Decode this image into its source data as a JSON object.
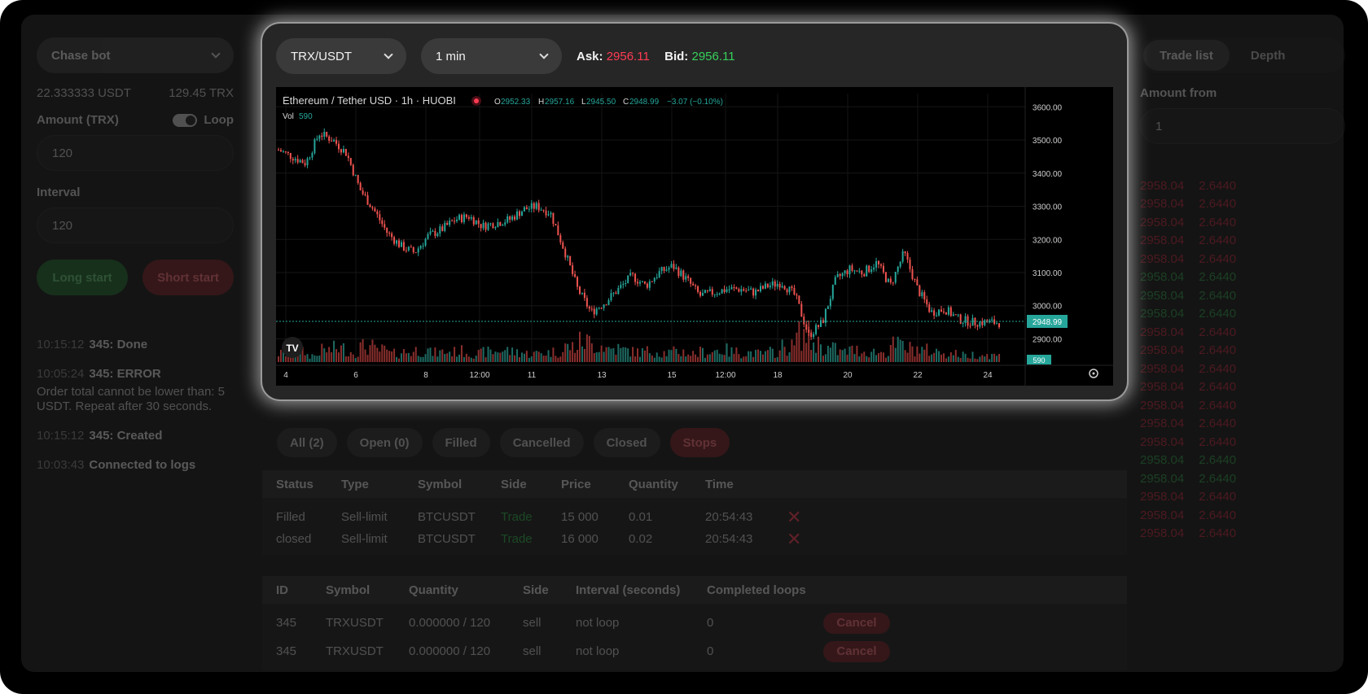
{
  "left": {
    "bot_select": "Chase bot",
    "balance_usdt": "22.333333 USDT",
    "balance_trx": "129.45 TRX",
    "amount_label": "Amount (TRX)",
    "loop_label": "Loop",
    "amount_value": "120",
    "interval_label": "Interval",
    "interval_value": "120",
    "long_button": "Long start",
    "short_button": "Short start",
    "logs": [
      {
        "time": "10:15:12",
        "msg": "345: Done",
        "detail": ""
      },
      {
        "time": "10:05:24",
        "msg": "345: ERROR",
        "detail": "Order total cannot be lower than: 5 USDT. Repeat after 30 seconds."
      },
      {
        "time": "10:15:12",
        "msg": "345: Created",
        "detail": ""
      },
      {
        "time": "10:03:43",
        "msg": "Connected to logs",
        "detail": ""
      }
    ]
  },
  "modal": {
    "pair": "TRX/USDT",
    "interval": "1 min",
    "ask_label": "Ask:",
    "ask_value": "2956.11",
    "bid_label": "Bid:",
    "bid_value": "2956.11"
  },
  "chart_data": {
    "type": "candlestick",
    "title": "Ethereum / Tether USD · 1h · HUOBI",
    "ohlc_text": {
      "o": "2952.33",
      "h": "2957.16",
      "l": "2945.50",
      "c": "2948.99",
      "chg": "−3.07 (−0.10%)"
    },
    "vol_label": "Vol",
    "vol_value": "590",
    "price_tag": "2948.99",
    "vol_tag": "590",
    "y_ticks": [
      "3600.00",
      "3500.00",
      "3400.00",
      "3300.00",
      "3200.00",
      "3100.00",
      "3000.00",
      "2900.00"
    ],
    "x_ticks": [
      "4",
      "6",
      "8",
      "12:00",
      "11",
      "13",
      "15",
      "12:00",
      "18",
      "20",
      "22",
      "24"
    ],
    "ylim": [
      2830,
      3640
    ],
    "close_path": [
      3470,
      3450,
      3430,
      3520,
      3500,
      3460,
      3350,
      3290,
      3220,
      3180,
      3160,
      3210,
      3230,
      3260,
      3270,
      3240,
      3250,
      3260,
      3290,
      3300,
      3280,
      3170,
      3050,
      2980,
      3010,
      3050,
      3090,
      3060,
      3100,
      3120,
      3080,
      3030,
      3040,
      3050,
      3050,
      3040,
      3060,
      3070,
      3030,
      2910,
      2950,
      3080,
      3110,
      3100,
      3130,
      3060,
      3160,
      3050,
      2980,
      2990,
      2960,
      2950,
      2950,
      2949
    ],
    "volume_path": [
      0.25,
      0.3,
      0.2,
      0.35,
      0.4,
      0.3,
      0.45,
      0.35,
      0.25,
      0.3,
      0.35,
      0.28,
      0.3,
      0.32,
      0.25,
      0.3,
      0.35,
      0.3,
      0.25,
      0.28,
      0.3,
      0.45,
      0.6,
      0.5,
      0.4,
      0.35,
      0.3,
      0.32,
      0.28,
      0.3,
      0.25,
      0.3,
      0.35,
      0.3,
      0.28,
      0.25,
      0.3,
      0.45,
      0.8,
      0.55,
      0.4,
      0.3,
      0.35,
      0.3,
      0.28,
      0.5,
      0.4,
      0.35,
      0.3,
      0.25,
      0.2,
      0.22,
      0.2,
      0.18
    ]
  },
  "tabs": [
    "All (2)",
    "Open (0)",
    "Filled",
    "Cancelled",
    "Closed",
    "Stops"
  ],
  "orders": {
    "headers": [
      "Status",
      "Type",
      "Symbol",
      "Side",
      "Price",
      "Quantity",
      "Time"
    ],
    "rows": [
      [
        "Filled",
        "Sell-limit",
        "BTCUSDT",
        "Trade",
        "15 000",
        "0.01",
        "20:54:43"
      ],
      [
        "closed",
        "Sell-limit",
        "BTCUSDT",
        "Trade",
        "16 000",
        "0.02",
        "20:54:43"
      ]
    ]
  },
  "bots": {
    "headers": [
      "ID",
      "Symbol",
      "Quantity",
      "Side",
      "Interval (seconds)",
      "Completed loops"
    ],
    "rows": [
      [
        "345",
        "TRXUSDT",
        "0.000000 / 120",
        "sell",
        "not loop",
        "0"
      ],
      [
        "345",
        "TRXUSDT",
        "0.000000 / 120",
        "sell",
        "not loop",
        "0"
      ]
    ],
    "cancel_label": "Cancel"
  },
  "right": {
    "tab_trade_list": "Trade list",
    "tab_depth": "Depth",
    "amount_from_label": "Amount from",
    "amount_from_value": "1",
    "orderbook": [
      {
        "price": "2958.04",
        "amount": "2.6440",
        "side": "red"
      },
      {
        "price": "2958.04",
        "amount": "2.6440",
        "side": "red"
      },
      {
        "price": "2958.04",
        "amount": "2.6440",
        "side": "red"
      },
      {
        "price": "2958.04",
        "amount": "2.6440",
        "side": "red"
      },
      {
        "price": "2958.04",
        "amount": "2.6440",
        "side": "red"
      },
      {
        "price": "2958.04",
        "amount": "2.6440",
        "side": "green"
      },
      {
        "price": "2958.04",
        "amount": "2.6440",
        "side": "green"
      },
      {
        "price": "2958.04",
        "amount": "2.6440",
        "side": "green"
      },
      {
        "price": "2958.04",
        "amount": "2.6440",
        "side": "red"
      },
      {
        "price": "2958.04",
        "amount": "2.6440",
        "side": "red"
      },
      {
        "price": "2958.04",
        "amount": "2.6440",
        "side": "red"
      },
      {
        "price": "2958.04",
        "amount": "2.6440",
        "side": "red"
      },
      {
        "price": "2958.04",
        "amount": "2.6440",
        "side": "red"
      },
      {
        "price": "2958.04",
        "amount": "2.6440",
        "side": "red"
      },
      {
        "price": "2958.04",
        "amount": "2.6440",
        "side": "red"
      },
      {
        "price": "2958.04",
        "amount": "2.6440",
        "side": "green"
      },
      {
        "price": "2958.04",
        "amount": "2.6440",
        "side": "green"
      },
      {
        "price": "2958.04",
        "amount": "2.6440",
        "side": "red"
      },
      {
        "price": "2958.04",
        "amount": "2.6440",
        "side": "red"
      },
      {
        "price": "2958.04",
        "amount": "2.6440",
        "side": "red"
      }
    ]
  },
  "colors": {
    "red": "#ff3b53",
    "green": "#37d05b",
    "teal": "#26a69a",
    "candle_red": "#ef5350"
  }
}
